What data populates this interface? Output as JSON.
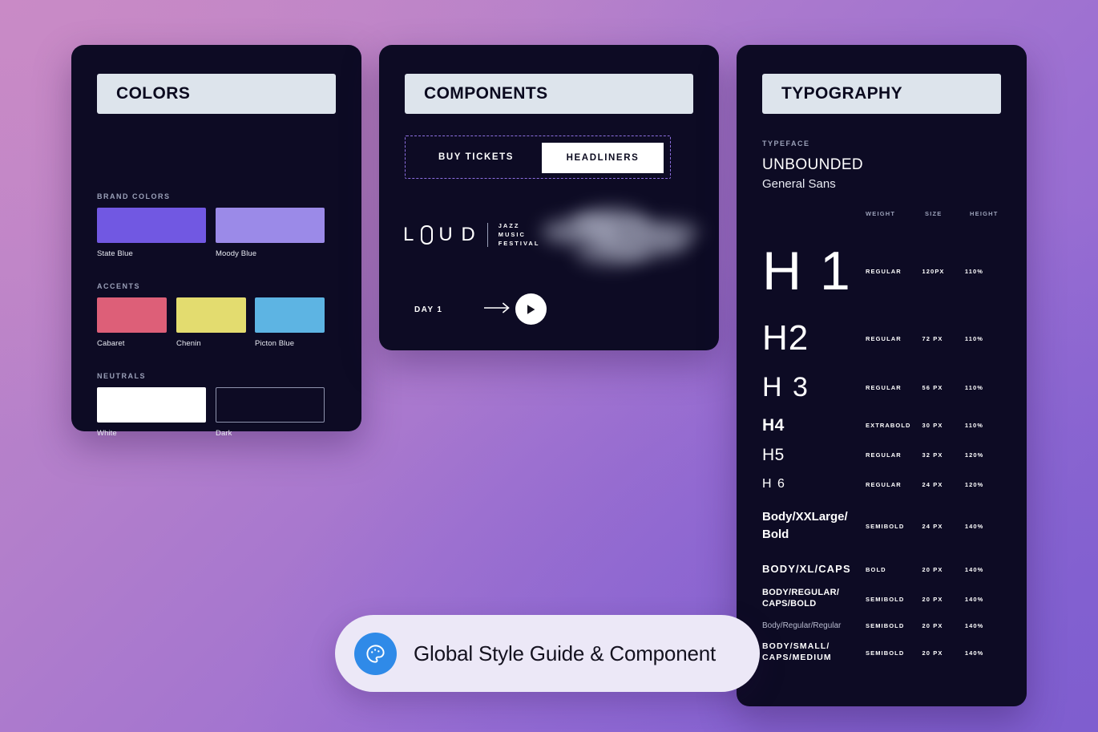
{
  "background": {
    "from": "#c98ac6",
    "to": "#7f5ecf"
  },
  "colors_panel": {
    "title": "COLORS",
    "sections": [
      {
        "label": "BRAND COLORS",
        "swatches": [
          {
            "name": "State Blue",
            "hex": "#7158e2",
            "outlined": false
          },
          {
            "name": "Moody Blue",
            "hex": "#9b8ae8",
            "outlined": false
          }
        ]
      },
      {
        "label": "ACCENTS",
        "swatches": [
          {
            "name": "Cabaret",
            "hex": "#dd5f78",
            "outlined": false
          },
          {
            "name": "Chenin",
            "hex": "#e3dc6f",
            "outlined": false
          },
          {
            "name": "Picton Blue",
            "hex": "#5db4e3",
            "outlined": false
          }
        ]
      },
      {
        "label": "NEUTRALS",
        "swatches": [
          {
            "name": "White",
            "hex": "#ffffff",
            "outlined": false
          },
          {
            "name": "Dark",
            "hex": "#0d0b24",
            "outlined": true
          }
        ]
      }
    ]
  },
  "components_panel": {
    "title": "COMPONENTS",
    "buttons": {
      "secondary_label": "BUY TICKETS",
      "primary_label": "HEADLINERS"
    },
    "logo": {
      "word_before": "L",
      "word_after": "U D",
      "subtitle_line1": "JAZZ",
      "subtitle_line2": "MUSIC",
      "subtitle_line3": "FESTIVAL"
    },
    "day_row": {
      "label": "DAY 1",
      "arrow_icon": "arrow-right-icon",
      "play_icon": "play-icon"
    }
  },
  "typography_panel": {
    "title": "TYPOGRAPHY",
    "typeface_label": "TYPEFACE",
    "typeface_primary": "UNBOUNDED",
    "typeface_secondary": "General Sans",
    "columns": {
      "weight": "WEIGHT",
      "size": "SIZE",
      "height": "HEIGHT"
    },
    "rows": [
      {
        "sample": "H 1",
        "weight": "REGULAR",
        "size": "120PX",
        "height": "110%"
      },
      {
        "sample": "H2",
        "weight": "REGULAR",
        "size": "72 PX",
        "height": "110%"
      },
      {
        "sample": "H 3",
        "weight": "REGULAR",
        "size": "56 PX",
        "height": "110%"
      },
      {
        "sample": "H4",
        "weight": "EXTRABOLD",
        "size": "30 PX",
        "height": "110%"
      },
      {
        "sample": "H5",
        "weight": "REGULAR",
        "size": "32 PX",
        "height": "120%"
      },
      {
        "sample": "H 6",
        "weight": "REGULAR",
        "size": "24 PX",
        "height": "120%"
      },
      {
        "sample": "Body/XXLarge/\nBold",
        "weight": "SEMIBOLD",
        "size": "24 PX",
        "height": "140%"
      },
      {
        "sample": "BODY/XL/CAPS",
        "weight": "BOLD",
        "size": "20 PX",
        "height": "140%"
      },
      {
        "sample": "BODY/REGULAR/\nCAPS/BOLD",
        "weight": "SEMIBOLD",
        "size": "20 PX",
        "height": "140%"
      },
      {
        "sample": "Body/Regular/Regular",
        "weight": "SEMIBOLD",
        "size": "20 PX",
        "height": "140%"
      },
      {
        "sample": "BODY/SMALL/\nCAPS/MEDIUM",
        "weight": "SEMIBOLD",
        "size": "20 PX",
        "height": "140%"
      }
    ]
  },
  "caption": {
    "text": "Global Style Guide & Component",
    "icon": "palette-icon",
    "icon_color": "#2f8ae8"
  }
}
